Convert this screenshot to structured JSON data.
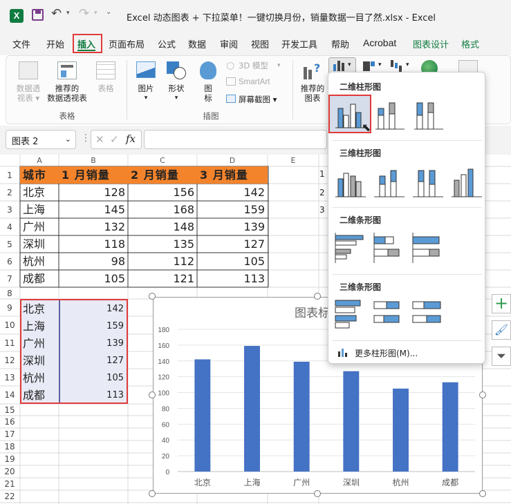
{
  "title_bar": {
    "app_icon": "excel-icon",
    "title": "Excel 动态图表 + 下拉菜单！一键切换月份，销量数据一目了然.xlsx  -  Excel"
  },
  "menu": [
    "文件",
    "开始",
    "插入",
    "页面布局",
    "公式",
    "数据",
    "审阅",
    "视图",
    "开发工具",
    "帮助",
    "Acrobat",
    "图表设计",
    "格式"
  ],
  "menu_active": "插入",
  "ribbon": {
    "pivot_label_1": "数据透",
    "pivot_label_2": "视表 ▾",
    "rec_pivot_1": "推荐的",
    "rec_pivot_2": "数据透视表",
    "table_label": "表格",
    "group_tables": "表格",
    "pictures_label": "图片",
    "shapes_label": "形状",
    "icons_label_1": "图",
    "icons_label_2": "标",
    "models3d_label": "3D 模型",
    "smartart_label": "SmartArt",
    "screenshot_label": "屏幕截图 ▾",
    "group_illustrations": "插图",
    "rec_charts_1": "推荐的",
    "rec_charts_2": "图表"
  },
  "formula_bar": {
    "name_box": "图表 2",
    "fx": "fx",
    "formula": ""
  },
  "columns": [
    "A",
    "B",
    "C",
    "D",
    "E"
  ],
  "rows": [
    "1",
    "2",
    "3",
    "4",
    "5",
    "6",
    "7",
    "8",
    "9",
    "10",
    "11",
    "12",
    "13",
    "14",
    "15",
    "16",
    "17",
    "18",
    "19",
    "20",
    "21",
    "22"
  ],
  "table": {
    "headers": [
      "城市",
      "1 月销量",
      "2 月销量",
      "3 月销量"
    ],
    "rows": [
      [
        "北京",
        "128",
        "156",
        "142"
      ],
      [
        "上海",
        "145",
        "168",
        "159"
      ],
      [
        "广州",
        "132",
        "148",
        "139"
      ],
      [
        "深圳",
        "118",
        "135",
        "127"
      ],
      [
        "杭州",
        "98",
        "112",
        "105"
      ],
      [
        "成都",
        "105",
        "121",
        "113"
      ]
    ]
  },
  "helper_table": [
    [
      "北京",
      "142"
    ],
    [
      "上海",
      "159"
    ],
    [
      "广州",
      "139"
    ],
    [
      "深圳",
      "127"
    ],
    [
      "杭州",
      "105"
    ],
    [
      "成都",
      "113"
    ]
  ],
  "side_row_numbers": [
    "1",
    "2",
    "3"
  ],
  "dropdown": {
    "sections": [
      "二维柱形图",
      "三维柱形图",
      "二维条形图",
      "三维条形图"
    ],
    "more_label": "更多柱形图(M)..."
  },
  "chart_data": {
    "type": "bar",
    "title": "图表标题",
    "categories": [
      "北京",
      "上海",
      "广州",
      "深圳",
      "杭州",
      "成都"
    ],
    "values": [
      142,
      159,
      139,
      127,
      105,
      113
    ],
    "ylim": [
      0,
      180
    ],
    "yticks": [
      "0",
      "20",
      "40",
      "60",
      "80",
      "100",
      "120",
      "140",
      "160",
      "180"
    ],
    "bar_color": "#4472c4",
    "grid": true
  },
  "colors": {
    "excel_green": "#107c41",
    "header_orange": "#f4842c",
    "highlight_red": "#e03a3a",
    "selection_purple": "#5b5ea6"
  }
}
